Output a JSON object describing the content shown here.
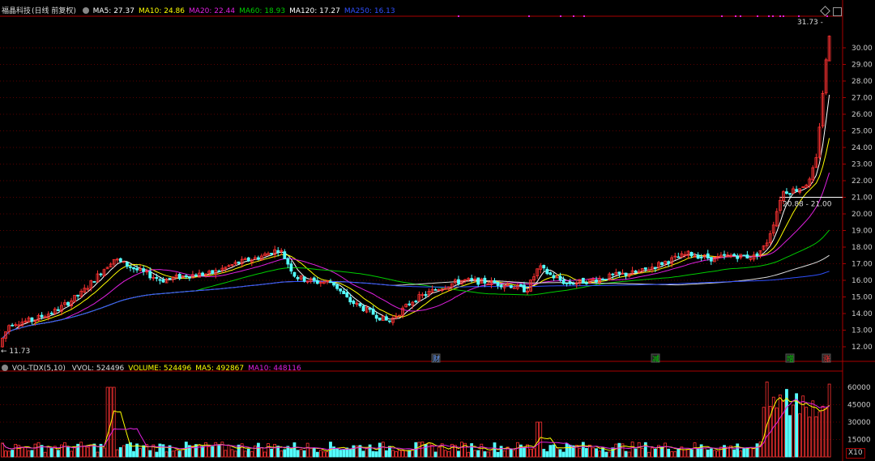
{
  "price_panel": {
    "stock_name": "福晶科技",
    "period_label": "(日线 前复权)",
    "indicators": [
      {
        "label": "MA5: 27.37",
        "color": "#ffffff"
      },
      {
        "label": "MA10: 24.86",
        "color": "#ffff00"
      },
      {
        "label": "MA20: 22.44",
        "color": "#e020e0"
      },
      {
        "label": "MA60: 18.93",
        "color": "#00cc00"
      },
      {
        "label": "MA120: 17.27",
        "color": "#ffffff"
      },
      {
        "label": "MA250: 16.13",
        "color": "#3050ff"
      }
    ],
    "y_ticks": [
      "30.00",
      "29.00",
      "28.00",
      "27.00",
      "26.00",
      "25.00",
      "24.00",
      "23.00",
      "22.00",
      "21.00",
      "20.00",
      "19.00",
      "18.00",
      "17.00",
      "16.00",
      "15.00",
      "14.00",
      "13.00",
      "12.00"
    ],
    "high_label": "31.73",
    "low_label": "11.73",
    "range_label": "20.88 - 21.00",
    "markers": [
      {
        "text": "财",
        "color": "#6aa0ff"
      },
      {
        "text": "减",
        "color": "#00d000"
      },
      {
        "text": "增",
        "color": "#00d000"
      },
      {
        "text": "涨",
        "color": "#ff3030"
      }
    ]
  },
  "volume_panel": {
    "title": "VOL-TDX(5,10)",
    "indicators": [
      {
        "label": "VVOL: 524496",
        "color": "#dddddd"
      },
      {
        "label": "VOLUME: 524496",
        "color": "#ffff00"
      },
      {
        "label": "MA5: 492867",
        "color": "#ffff00"
      },
      {
        "label": "MA10: 448116",
        "color": "#e020e0"
      }
    ],
    "y_ticks": [
      "60000",
      "45000",
      "30000",
      "15000"
    ],
    "unit_label": "X10"
  },
  "colors": {
    "up": "#ff3232",
    "down": "#54ffff",
    "grid": "#5a0000",
    "axis": "#aa0000"
  }
}
